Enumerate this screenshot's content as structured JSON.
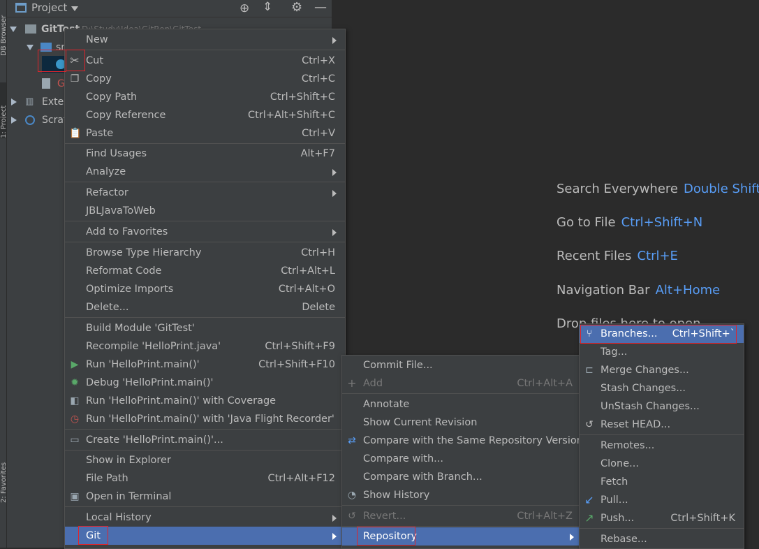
{
  "sidebar_tabs": {
    "top": "DB Browser",
    "middle": "1: Project",
    "bottom": "2: Favorites"
  },
  "project": {
    "title": "Project",
    "root_name": "GitTest",
    "root_path": "D:\\Study\\Idea\\GitRep\\GitTest",
    "src_label": "src",
    "file_label": "G",
    "external_label": "External Libraries",
    "scratch_label": "Scratches and Consoles"
  },
  "welcome": [
    {
      "text": "Search Everywhere",
      "key": "Double Shift"
    },
    {
      "text": "Go to File",
      "key": "Ctrl+Shift+N"
    },
    {
      "text": "Recent Files",
      "key": "Ctrl+E"
    },
    {
      "text": "Navigation Bar",
      "key": "Alt+Home"
    },
    {
      "text": "Drop files here to open",
      "key": ""
    }
  ],
  "context_menu": {
    "items": [
      {
        "label": "New",
        "shortcut": "",
        "submenu": true
      },
      {
        "label": "Cut",
        "shortcut": "Ctrl+X",
        "icon": "scissors-icon"
      },
      {
        "label": "Copy",
        "shortcut": "Ctrl+C",
        "icon": "copy-icon"
      },
      {
        "label": "Copy Path",
        "shortcut": "Ctrl+Shift+C"
      },
      {
        "label": "Copy Reference",
        "shortcut": "Ctrl+Alt+Shift+C"
      },
      {
        "label": "Paste",
        "shortcut": "Ctrl+V",
        "icon": "paste-icon"
      },
      {
        "label": "Find Usages",
        "shortcut": "Alt+F7"
      },
      {
        "label": "Analyze",
        "shortcut": "",
        "submenu": true
      },
      {
        "label": "Refactor",
        "shortcut": "",
        "submenu": true
      },
      {
        "label": "JBLJavaToWeb",
        "shortcut": ""
      },
      {
        "label": "Add to Favorites",
        "shortcut": "",
        "submenu": true
      },
      {
        "label": "Browse Type Hierarchy",
        "shortcut": "Ctrl+H"
      },
      {
        "label": "Reformat Code",
        "shortcut": "Ctrl+Alt+L"
      },
      {
        "label": "Optimize Imports",
        "shortcut": "Ctrl+Alt+O"
      },
      {
        "label": "Delete...",
        "shortcut": "Delete"
      },
      {
        "label": "Build Module 'GitTest'",
        "shortcut": ""
      },
      {
        "label": "Recompile 'HelloPrint.java'",
        "shortcut": "Ctrl+Shift+F9"
      },
      {
        "label": "Run 'HelloPrint.main()'",
        "shortcut": "Ctrl+Shift+F10",
        "icon": "run-icon"
      },
      {
        "label": "Debug 'HelloPrint.main()'",
        "shortcut": "",
        "icon": "debug-icon"
      },
      {
        "label": "Run 'HelloPrint.main()' with Coverage",
        "shortcut": "",
        "icon": "coverage-icon"
      },
      {
        "label": "Run 'HelloPrint.main()' with 'Java Flight Recorder'",
        "shortcut": "",
        "icon": "flight-recorder-icon"
      },
      {
        "label": "Create 'HelloPrint.main()'...",
        "shortcut": "",
        "icon": "create-config-icon"
      },
      {
        "label": "Show in Explorer",
        "shortcut": ""
      },
      {
        "label": "File Path",
        "shortcut": "Ctrl+Alt+F12"
      },
      {
        "label": "Open in Terminal",
        "shortcut": "",
        "icon": "terminal-icon"
      },
      {
        "label": "Local History",
        "shortcut": "",
        "submenu": true
      },
      {
        "label": "Git",
        "shortcut": "",
        "submenu": true,
        "selected": true
      }
    ]
  },
  "git_menu": {
    "items": [
      {
        "label": "Commit File...",
        "shortcut": ""
      },
      {
        "label": "Add",
        "shortcut": "Ctrl+Alt+A",
        "disabled": true,
        "icon": "plus-icon"
      },
      {
        "label": "Annotate",
        "shortcut": ""
      },
      {
        "label": "Show Current Revision",
        "shortcut": ""
      },
      {
        "label": "Compare with the Same Repository Version",
        "shortcut": "",
        "icon": "compare-icon"
      },
      {
        "label": "Compare with...",
        "shortcut": ""
      },
      {
        "label": "Compare with Branch...",
        "shortcut": ""
      },
      {
        "label": "Show History",
        "shortcut": "",
        "icon": "history-icon"
      },
      {
        "label": "Revert...",
        "shortcut": "Ctrl+Alt+Z",
        "disabled": true,
        "icon": "revert-icon"
      },
      {
        "label": "Repository",
        "shortcut": "",
        "submenu": true,
        "selected": true
      }
    ]
  },
  "repo_menu": {
    "items": [
      {
        "label": "Branches...",
        "shortcut": "Ctrl+Shift+`",
        "selected": true,
        "icon": "branch-icon"
      },
      {
        "label": "Tag...",
        "shortcut": ""
      },
      {
        "label": "Merge Changes...",
        "shortcut": "",
        "icon": "merge-icon"
      },
      {
        "label": "Stash Changes...",
        "shortcut": ""
      },
      {
        "label": "UnStash Changes...",
        "shortcut": ""
      },
      {
        "label": "Reset HEAD...",
        "shortcut": "",
        "icon": "reset-icon"
      },
      {
        "label": "Remotes...",
        "shortcut": ""
      },
      {
        "label": "Clone...",
        "shortcut": ""
      },
      {
        "label": "Fetch",
        "shortcut": ""
      },
      {
        "label": "Pull...",
        "shortcut": "",
        "icon": "pull-icon"
      },
      {
        "label": "Push...",
        "shortcut": "Ctrl+Shift+K",
        "icon": "push-icon"
      },
      {
        "label": "Rebase...",
        "shortcut": ""
      }
    ]
  }
}
